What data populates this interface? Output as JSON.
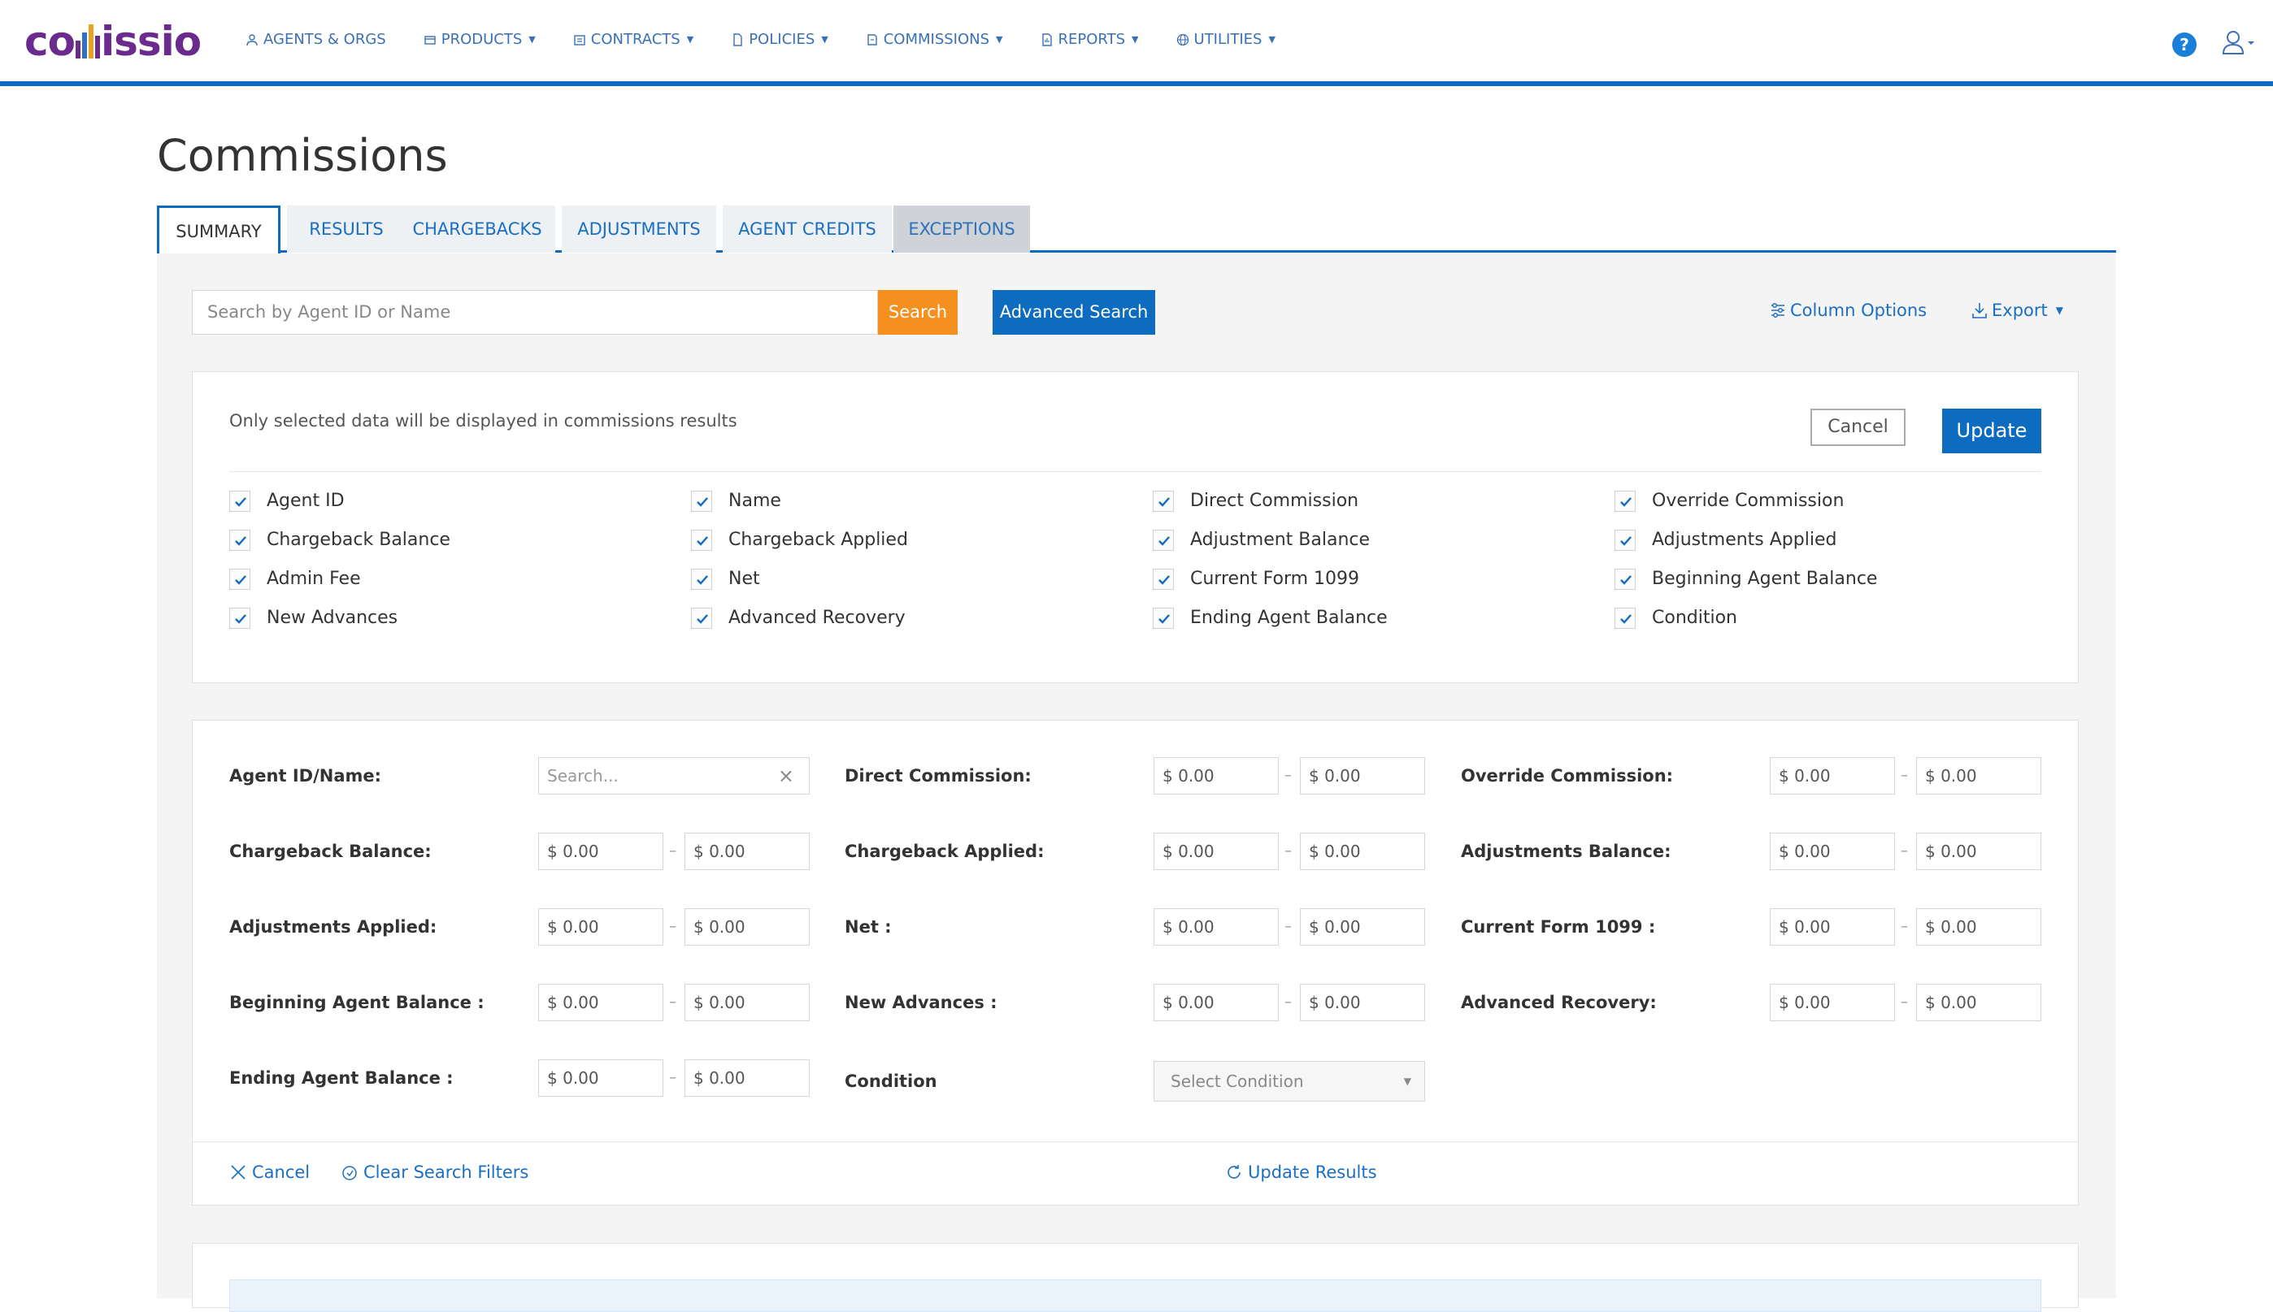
{
  "app": {
    "logo_text_left": "co",
    "logo_text_right": "issio"
  },
  "nav": [
    {
      "label": "AGENTS & ORGS",
      "icon": "agents-icon",
      "dropdown": false
    },
    {
      "label": "PRODUCTS",
      "icon": "products-icon",
      "dropdown": true
    },
    {
      "label": "CONTRACTS",
      "icon": "contracts-icon",
      "dropdown": true
    },
    {
      "label": "POLICIES",
      "icon": "policies-icon",
      "dropdown": true
    },
    {
      "label": "COMMISSIONS",
      "icon": "commissions-icon",
      "dropdown": true
    },
    {
      "label": "REPORTS",
      "icon": "reports-icon",
      "dropdown": true
    },
    {
      "label": "UTILITIES",
      "icon": "globe-icon",
      "dropdown": true
    }
  ],
  "header": {
    "help_glyph": "?"
  },
  "page": {
    "title": "Commissions"
  },
  "tabs": [
    {
      "label": "SUMMARY"
    },
    {
      "label": "RESULTS"
    },
    {
      "label": "CHARGEBACKS"
    },
    {
      "label": "ADJUSTMENTS"
    },
    {
      "label": "AGENT CREDITS"
    },
    {
      "label": "EXCEPTIONS"
    }
  ],
  "toolbar": {
    "search_placeholder": "Search by Agent ID or Name",
    "search_label": "Search",
    "advanced_label": "Advanced Search",
    "column_options_label": "Column Options",
    "export_label": "Export"
  },
  "column_options": {
    "note": "Only selected data will be displayed in commissions results",
    "cancel_label": "Cancel",
    "update_label": "Update",
    "items": [
      "Agent ID",
      "Name",
      "Direct Commission",
      "Override Commission",
      "Chargeback Balance",
      "Chargeback Applied",
      "Adjustment Balance",
      "Adjustments Applied",
      "Admin Fee",
      "Net",
      "Current Form 1099",
      "Beginning Agent Balance",
      "New Advances",
      "Advanced Recovery",
      "Ending Agent Balance",
      "Condition"
    ]
  },
  "filters": {
    "agent_label": "Agent ID/Name:",
    "agent_placeholder": "Search...",
    "clear_glyph": "×",
    "amount_default": "$ 0.00",
    "range_sep": "–",
    "rows": [
      [
        "Direct Commission:",
        "Override Commission:"
      ],
      [
        "Chargeback Balance:",
        "Chargeback Applied:",
        "Adjustments Balance:"
      ],
      [
        "Adjustments Applied:",
        "Net :",
        "Current Form 1099 :"
      ],
      [
        "Beginning Agent Balance :",
        "New Advances :",
        "Advanced Recovery:"
      ],
      [
        "Ending Agent Balance :"
      ]
    ],
    "condition_label": "Condition",
    "condition_placeholder": "Select Condition",
    "cancel_label": "Cancel",
    "clear_label": "Clear Search Filters",
    "update_label": "Update Results"
  }
}
